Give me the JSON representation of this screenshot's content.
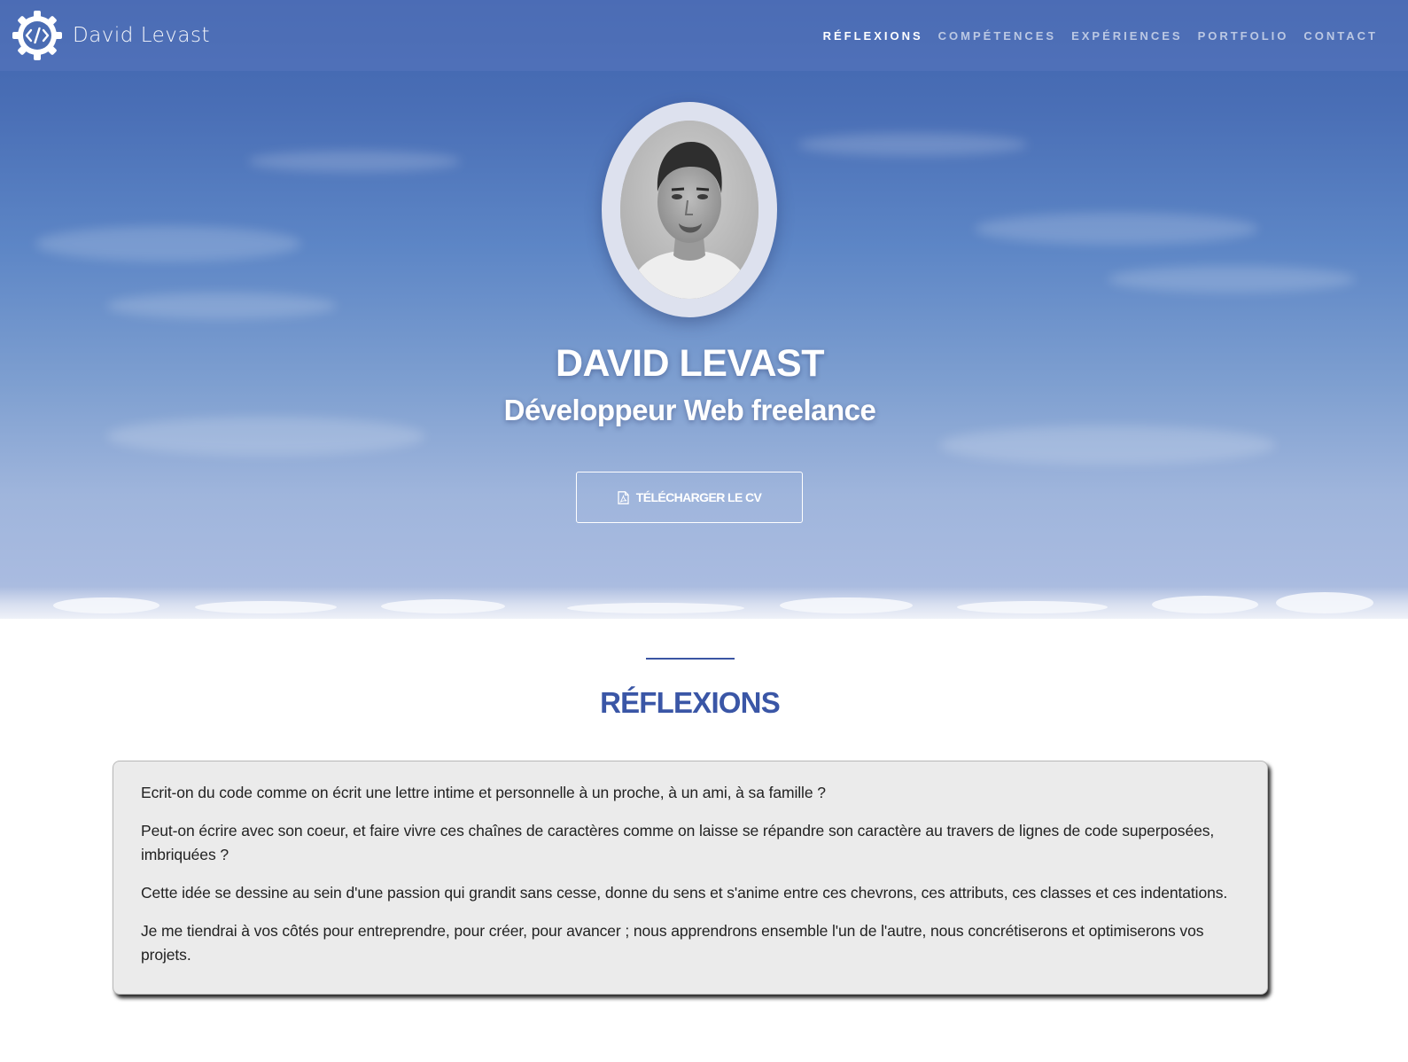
{
  "brand": {
    "name": "David Levast",
    "logo_icon": "gear-code-icon"
  },
  "nav": {
    "items": [
      {
        "label": "RÉFLEXIONS",
        "active": true
      },
      {
        "label": "COMPÉTENCES",
        "active": false
      },
      {
        "label": "EXPÉRIENCES",
        "active": false
      },
      {
        "label": "PORTFOLIO",
        "active": false
      },
      {
        "label": "CONTACT",
        "active": false
      }
    ]
  },
  "hero": {
    "name": "DAVID LEVAST",
    "subtitle": "Développeur Web freelance",
    "cv_button_label": "TÉLÉCHARGER LE CV",
    "cv_button_icon": "pdf-file-icon",
    "portrait_icon": "portrait-photo"
  },
  "section": {
    "title": "RÉFLEXIONS",
    "paragraphs": [
      "Ecrit-on du code comme on écrit une lettre intime et personnelle à un proche, à un ami, à sa famille ?",
      "Peut-on écrire avec son coeur, et faire vivre ces chaînes de caractères comme on laisse se répandre son caractère au travers de lignes de code superposées, imbriquées ?",
      "Cette idée se dessine au sein d'une passion qui grandit sans cesse, donne du sens et s'anime entre ces chevrons, ces attributs, ces classes et ces indentations.",
      "Je me tiendrai à vos côtés pour entreprendre, pour créer, pour avancer ; nous apprendrons ensemble l'un de l'autre, nous concrétiserons et optimiserons vos projets."
    ]
  },
  "colors": {
    "accent": "#3a56a6",
    "sky_top": "#3f63ad",
    "sky_bottom": "#b7c4e2",
    "card_bg": "#ebebeb"
  }
}
